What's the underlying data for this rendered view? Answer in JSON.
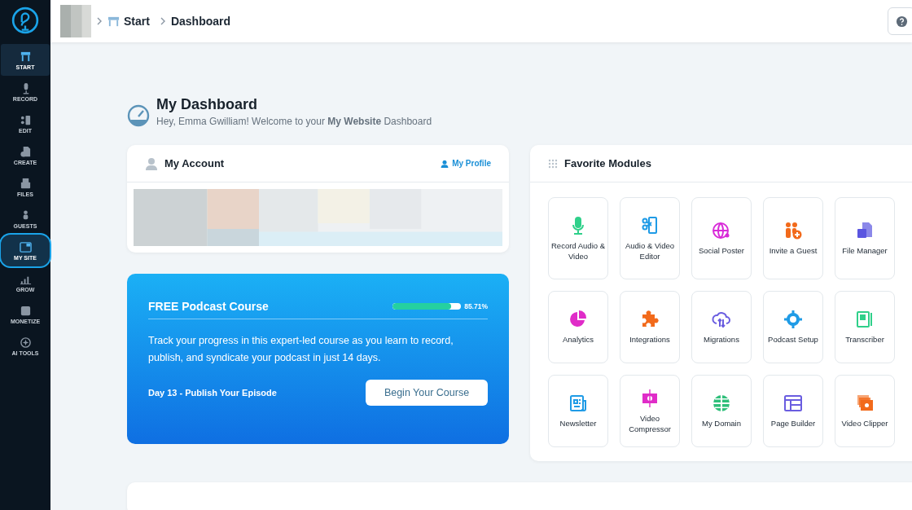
{
  "sidebar": {
    "items": [
      {
        "label": "START",
        "kind": "start",
        "selected": true,
        "highlighted": false
      },
      {
        "label": "RECORD",
        "kind": "mic",
        "selected": false,
        "highlighted": false
      },
      {
        "label": "EDIT",
        "kind": "edit",
        "selected": false,
        "highlighted": false
      },
      {
        "label": "CREATE",
        "kind": "create",
        "selected": false,
        "highlighted": false
      },
      {
        "label": "FILES",
        "kind": "files",
        "selected": false,
        "highlighted": false
      },
      {
        "label": "GUESTS",
        "kind": "guests",
        "selected": false,
        "highlighted": false
      },
      {
        "label": "MY SITE",
        "kind": "site",
        "selected": false,
        "highlighted": true
      },
      {
        "label": "GROW",
        "kind": "grow",
        "selected": false,
        "highlighted": false
      },
      {
        "label": "MONETIZE",
        "kind": "monetize",
        "selected": false,
        "highlighted": false
      },
      {
        "label": "AI TOOLS",
        "kind": "ai",
        "selected": false,
        "highlighted": false
      }
    ]
  },
  "breadcrumb": [
    "Start",
    "Dashboard"
  ],
  "heading": {
    "title": "My Dashboard",
    "subtitle": "Hey, Emma Gwilliam! Welcome to your **My Website** Dashboard"
  },
  "account": {
    "title": "My Account",
    "link": "My Profile"
  },
  "course": {
    "title": "FREE Podcast Course",
    "level": 0.8571,
    "reading": "85.71%",
    "text": "Track your progress in this expert-led course as you learn to record, publish, and syndicate your podcast in just 14 days.",
    "day": "Day 13 - Publish Your Episode",
    "button": "Begin Your Course"
  },
  "modules": {
    "title": "Favorite Modules",
    "items": [
      {
        "label": "Record Audio & Video",
        "kind": "mic",
        "color": "#2fd08a"
      },
      {
        "label": "Audio & Video Editor",
        "kind": "editor",
        "color": "#1f9be6"
      },
      {
        "label": "Social Poster",
        "kind": "globe-share",
        "color": "#d82bd8"
      },
      {
        "label": "Invite a Guest",
        "kind": "people",
        "color": "#f26a1b"
      },
      {
        "label": "File Manager",
        "kind": "file",
        "color": "#5a55e0"
      },
      {
        "label": "Analytics",
        "kind": "pie",
        "color": "#e02cc8"
      },
      {
        "label": "Integrations",
        "kind": "puzzle",
        "color": "#f26a1b"
      },
      {
        "label": "Migrations",
        "kind": "cloud",
        "color": "#6a5de0"
      },
      {
        "label": "Podcast Setup",
        "kind": "gear",
        "color": "#1f9be6"
      },
      {
        "label": "Transcriber",
        "kind": "notebook",
        "color": "#2fd08a"
      },
      {
        "label": "Newsletter",
        "kind": "news",
        "color": "#1f9be6"
      },
      {
        "label": "Video Compressor",
        "kind": "film",
        "color": "#e02cc8"
      },
      {
        "label": "My Domain",
        "kind": "globe",
        "color": "#2fbf7a"
      },
      {
        "label": "Page Builder",
        "kind": "layout",
        "color": "#6a5de0"
      },
      {
        "label": "Video Clipper",
        "kind": "clips",
        "color": "#f26a1b"
      }
    ]
  }
}
